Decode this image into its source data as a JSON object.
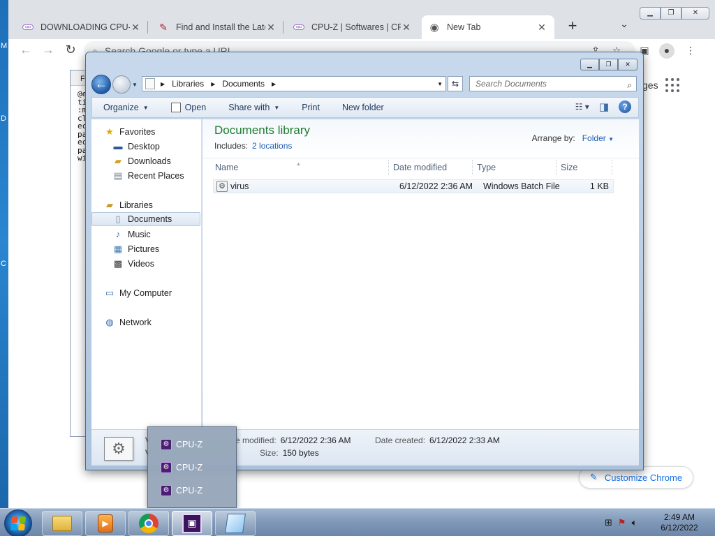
{
  "chrome": {
    "tabs": [
      {
        "title": "DOWNLOADING CPU-Z",
        "favicon": "cpuz-icon",
        "active": false
      },
      {
        "title": "Find and Install the Late",
        "favicon": "feather-icon",
        "active": false
      },
      {
        "title": "CPU-Z | Softwares | CPU",
        "favicon": "cpuz-icon",
        "active": false
      },
      {
        "title": "New Tab",
        "favicon": "chrome-icon",
        "active": true
      }
    ],
    "omnibox_placeholder": "Search Google or type a URL",
    "ntp_partial_text": "ges",
    "customize_label": "Customize Chrome"
  },
  "background_window": {
    "menu": "F",
    "lines": [
      "@e",
      "ti",
      ":m",
      "cl",
      "ec",
      "pa",
      "ec",
      "pa",
      "wi"
    ]
  },
  "desktop_letters": [
    "M",
    "D",
    "C"
  ],
  "explorer": {
    "breadcrumb": [
      "Libraries",
      "Documents"
    ],
    "search_placeholder": "Search Documents",
    "commands": [
      "Organize",
      "Open",
      "Share with",
      "Print",
      "New folder"
    ],
    "nav": {
      "favorites": {
        "label": "Favorites",
        "items": [
          "Desktop",
          "Downloads",
          "Recent Places"
        ]
      },
      "libraries": {
        "label": "Libraries",
        "items": [
          "Documents",
          "Music",
          "Pictures",
          "Videos"
        ]
      },
      "computer": "My Computer",
      "network": "Network"
    },
    "library": {
      "title": "Documents library",
      "includes_label": "Includes:",
      "locations_link": "2 locations",
      "arrange_label": "Arrange by:",
      "arrange_value": "Folder"
    },
    "columns": [
      "Name",
      "Date modified",
      "Type",
      "Size"
    ],
    "files": [
      {
        "name": "virus",
        "modified": "6/12/2022 2:36 AM",
        "type": "Windows Batch File",
        "size": "1 KB"
      }
    ],
    "details": {
      "name_partial": "V",
      "type_partial": "V",
      "modified_label": "e modified:",
      "modified_value": "6/12/2022 2:36 AM",
      "created_label": "Date created:",
      "created_value": "6/12/2022 2:33 AM",
      "size_label": "Size:",
      "size_value": "150 bytes"
    }
  },
  "jumplist": {
    "items": [
      "CPU-Z",
      "CPU-Z",
      "CPU-Z"
    ]
  },
  "taskbar": {
    "clock_time": "2:49 AM",
    "clock_date": "6/12/2022"
  },
  "colors": {
    "library_title": "#1e7d2f",
    "link": "#1f5fb4",
    "chrome_blue": "#1a73e8"
  }
}
